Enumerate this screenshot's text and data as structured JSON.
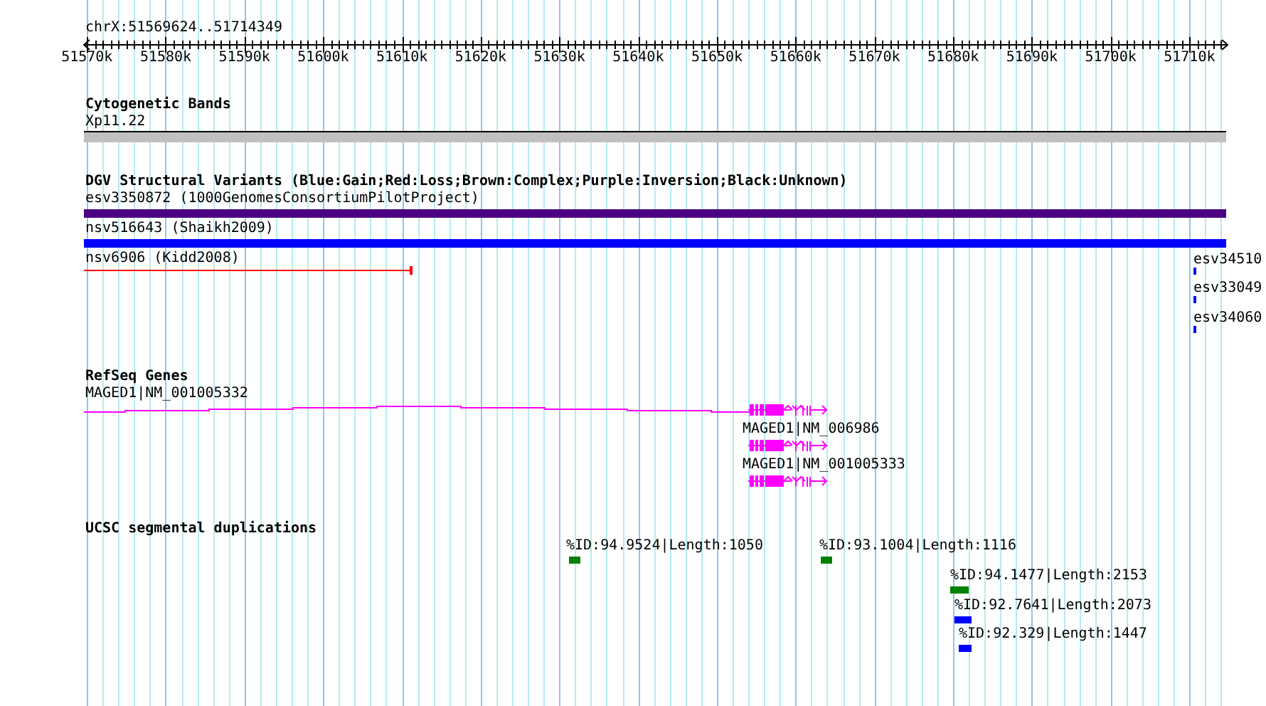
{
  "position": "chrX:51569624..51714349",
  "ruler": {
    "labels": [
      "51570k",
      "51580k",
      "51590k",
      "51600k",
      "51610k",
      "51620k",
      "51630k",
      "51640k",
      "51650k",
      "51660k",
      "51670k",
      "51680k",
      "51690k",
      "51700k",
      "51710k"
    ]
  },
  "tracks": [
    {
      "kind": "bands",
      "title": "Cytogenetic Bands",
      "features": [
        {
          "label": "Xp11.22",
          "color": "#c0c0c0"
        }
      ]
    },
    {
      "kind": "variants",
      "title": "DGV Structural Variants (Blue:Gain;Red:Loss;Brown:Complex;Purple:Inversion;Black:Unknown)",
      "features": [
        {
          "label": "esv3350872 (1000GenomesConsortiumPilotProject)",
          "color": "#4b0082"
        },
        {
          "label": "nsv516643 (Shaikh2009)",
          "color": "#0000ff"
        },
        {
          "label": "nsv6906 (Kidd2008)",
          "color": "#ff0000"
        },
        {
          "label": "esv34510",
          "color": "#0000ff"
        },
        {
          "label": "esv33049",
          "color": "#0000ff"
        },
        {
          "label": "esv34060",
          "color": "#0000ff"
        }
      ]
    },
    {
      "kind": "genes",
      "title": "RefSeq Genes",
      "features": [
        {
          "label": "MAGED1|NM_001005332",
          "color": "#ff00ff"
        },
        {
          "label": "MAGED1|NM_006986",
          "color": "#ff00ff"
        },
        {
          "label": "MAGED1|NM_001005333",
          "color": "#ff00ff"
        }
      ]
    },
    {
      "kind": "duplications",
      "title": "UCSC segmental duplications",
      "features": [
        {
          "label": "%ID:94.9524|Length:1050",
          "color": "#008000"
        },
        {
          "label": "%ID:93.1004|Length:1116",
          "color": "#008000"
        },
        {
          "label": "%ID:94.1477|Length:2153",
          "color": "#008000"
        },
        {
          "label": "%ID:92.7641|Length:2073",
          "color": "#0000ff"
        },
        {
          "label": "%ID:92.329|Length:1447",
          "color": "#0000ff"
        }
      ]
    }
  ]
}
